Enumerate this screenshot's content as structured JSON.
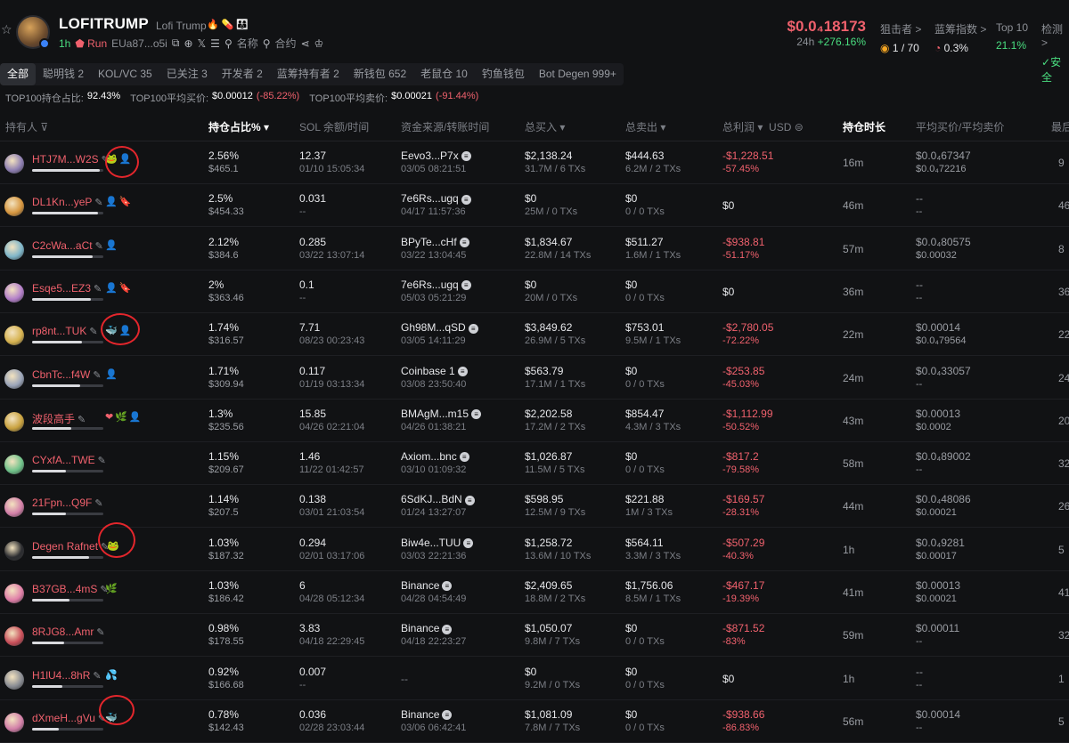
{
  "header": {
    "name": "LOFITRUMP",
    "sub": "Lofi Trump",
    "badges": [
      "🔥",
      "💊",
      "👨‍👩‍👦"
    ],
    "age": "1h",
    "run": "Run",
    "ca": "EUa87...o5i",
    "links": [
      "名称",
      "合约"
    ],
    "price": "$0.0₄18173",
    "change_label": "24h",
    "change": "+276.16%",
    "stats": [
      {
        "label": "狙击者 >",
        "value": "1 / 70",
        "green": false
      },
      {
        "label": "蓝筹指数 >",
        "value": "0.3%",
        "green": false
      },
      {
        "label": "Top 10",
        "value": "21.1%",
        "green": true
      },
      {
        "label": "检测 >",
        "value": "安全",
        "green": true
      }
    ]
  },
  "tabs": [
    "全部",
    "聪明钱 2",
    "KOL/VC 35",
    "已关注 3",
    "开发者 2",
    "蓝筹持有者 2",
    "新钱包 652",
    "老鼠仓 10",
    "钓鱼钱包",
    "Bot Degen 999+"
  ],
  "metrics": {
    "l1": "TOP100持仓占比:",
    "v1": "92.43%",
    "l2": "TOP100平均买价:",
    "v2": "$0.00012",
    "v2c": "(-85.22%)",
    "l3": "TOP100平均卖价:",
    "v3": "$0.00021",
    "v3c": "(-91.44%)"
  },
  "columns": [
    "持有人",
    "持仓占比%",
    "SOL 余额/时间",
    "资金来源/转账时间",
    "总买入",
    "总卖出",
    "总利润",
    "USD",
    "持仓时长",
    "平均买价/平均卖价",
    "最后"
  ],
  "colors": {
    "accent_red": "#f0616d",
    "accent_green": "#4ade80",
    "bg": "#111214"
  },
  "rows": [
    {
      "addr": "HTJ7M...W2S",
      "tags": [
        "🐸",
        "👤"
      ],
      "pct": "2.56%",
      "usd": "$465.1",
      "bar": 0.95,
      "sol": "12.37",
      "sol_t": "01/10 15:05:34",
      "src": "Eevo3...P7x",
      "src_t": "03/05 08:21:51",
      "buy": "$2,138.24",
      "buy_s": "31.7M / 6 TXs",
      "sell": "$444.63",
      "sell_s": "6.2M / 2 TXs",
      "profit": "-$1,228.51",
      "profit_p": "-57.45%",
      "hold": "16m",
      "avg_b": "$0.0₄67347",
      "avg_s": "$0.0₄72216",
      "last": "9",
      "av": "#8e7fb2"
    },
    {
      "addr": "DL1Kn...yeP",
      "tags": [
        "👤",
        "🔖"
      ],
      "pct": "2.5%",
      "usd": "$454.33",
      "bar": 0.93,
      "sol": "0.031",
      "sol_t": "--",
      "src": "7e6Rs...ugq",
      "src_t": "04/17 11:57:36",
      "buy": "$0",
      "buy_s": "25M / 0 TXs",
      "sell": "$0",
      "sell_s": "0 / 0 TXs",
      "profit": "$0",
      "profit_p": "",
      "hold": "46m",
      "avg_b": "--",
      "avg_s": "--",
      "last": "46",
      "av": "#d6963f"
    },
    {
      "addr": "C2cWa...aCt",
      "tags": [
        "👤"
      ],
      "pct": "2.12%",
      "usd": "$384.6",
      "bar": 0.85,
      "sol": "0.285",
      "sol_t": "03/22 13:07:14",
      "src": "BPyTe...cHf",
      "src_t": "03/22 13:04:45",
      "buy": "$1,834.67",
      "buy_s": "22.8M / 14 TXs",
      "sell": "$511.27",
      "sell_s": "1.6M / 1 TXs",
      "profit": "-$938.81",
      "profit_p": "-51.17%",
      "hold": "57m",
      "avg_b": "$0.0₄80575",
      "avg_s": "$0.00032",
      "last": "8",
      "av": "#7fb6c9"
    },
    {
      "addr": "Esqe5...EZ3",
      "tags": [
        "👤",
        "🔖"
      ],
      "pct": "2%",
      "usd": "$363.46",
      "bar": 0.82,
      "sol": "0.1",
      "sol_t": "--",
      "src": "7e6Rs...ugq",
      "src_t": "05/03 05:21:29",
      "buy": "$0",
      "buy_s": "20M / 0 TXs",
      "sell": "$0",
      "sell_s": "0 / 0 TXs",
      "profit": "$0",
      "profit_p": "",
      "hold": "36m",
      "avg_b": "--",
      "avg_s": "--",
      "last": "36",
      "av": "#b37fc9"
    },
    {
      "addr": "rp8nt...TUK",
      "tags": [
        "🐳",
        "👤"
      ],
      "pct": "1.74%",
      "usd": "$316.57",
      "bar": 0.7,
      "sol": "7.71",
      "sol_t": "08/23 00:23:43",
      "src": "Gh98M...qSD",
      "src_t": "03/05 14:11:29",
      "buy": "$3,849.62",
      "buy_s": "26.9M / 5 TXs",
      "sell": "$753.01",
      "sell_s": "9.5M / 1 TXs",
      "profit": "-$2,780.05",
      "profit_p": "-72.22%",
      "hold": "22m",
      "avg_b": "$0.00014",
      "avg_s": "$0.0₄79564",
      "last": "22",
      "av": "#d6b24f"
    },
    {
      "addr": "CbnTc...f4W",
      "tags": [
        "👤"
      ],
      "pct": "1.71%",
      "usd": "$309.94",
      "bar": 0.68,
      "sol": "0.117",
      "sol_t": "01/19 03:13:34",
      "src": "Coinbase 1",
      "src_t": "03/08 23:50:40",
      "buy": "$563.79",
      "buy_s": "17.1M / 1 TXs",
      "sell": "$0",
      "sell_s": "0 / 0 TXs",
      "profit": "-$253.85",
      "profit_p": "-45.03%",
      "hold": "24m",
      "avg_b": "$0.0₄33057",
      "avg_s": "--",
      "last": "24",
      "av": "#9aa4b8"
    },
    {
      "addr": "波段高手",
      "tags": [
        "❤",
        "🌿",
        "👤"
      ],
      "pct": "1.3%",
      "usd": "$235.56",
      "bar": 0.55,
      "sol": "15.85",
      "sol_t": "04/26 02:21:04",
      "src": "BMAgM...m15",
      "src_t": "04/26 01:38:21",
      "buy": "$2,202.58",
      "buy_s": "17.2M / 2 TXs",
      "sell": "$854.47",
      "sell_s": "4.3M / 3 TXs",
      "profit": "-$1,112.99",
      "profit_p": "-50.52%",
      "hold": "43m",
      "avg_b": "$0.00013",
      "avg_s": "$0.0002",
      "last": "20",
      "av": "#c9a23f"
    },
    {
      "addr": "CYxfA...TWE",
      "tags": [],
      "pct": "1.15%",
      "usd": "$209.67",
      "bar": 0.48,
      "sol": "1.46",
      "sol_t": "11/22 01:42:57",
      "src": "Axiom...bnc",
      "src_t": "03/10 01:09:32",
      "buy": "$1,026.87",
      "buy_s": "11.5M / 5 TXs",
      "sell": "$0",
      "sell_s": "0 / 0 TXs",
      "profit": "-$817.2",
      "profit_p": "-79.58%",
      "hold": "58m",
      "avg_b": "$0.0₄89002",
      "avg_s": "--",
      "last": "32",
      "av": "#6fc28a"
    },
    {
      "addr": "21Fpn...Q9F",
      "tags": [],
      "pct": "1.14%",
      "usd": "$207.5",
      "bar": 0.47,
      "sol": "0.138",
      "sol_t": "03/01 21:03:54",
      "src": "6SdKJ...BdN",
      "src_t": "01/24 13:27:07",
      "buy": "$598.95",
      "buy_s": "12.5M / 9 TXs",
      "sell": "$221.88",
      "sell_s": "1M / 3 TXs",
      "profit": "-$169.57",
      "profit_p": "-28.31%",
      "hold": "44m",
      "avg_b": "$0.0₄48086",
      "avg_s": "$0.00021",
      "last": "26",
      "av": "#d27fa8"
    },
    {
      "addr": "Degen Rafnet",
      "tags": [
        "🐸"
      ],
      "pct": "1.03%",
      "usd": "$187.32",
      "bar": 0.8,
      "sol": "0.294",
      "sol_t": "02/01 03:17:06",
      "src": "Biw4e...TUU",
      "src_t": "03/03 22:21:36",
      "buy": "$1,258.72",
      "buy_s": "13.6M / 10 TXs",
      "sell": "$564.11",
      "sell_s": "3.3M / 3 TXs",
      "profit": "-$507.29",
      "profit_p": "-40.3%",
      "hold": "1h",
      "avg_b": "$0.0₄9281",
      "avg_s": "$0.00017",
      "last": "5",
      "av": "#2b2c30"
    },
    {
      "addr": "B37GB...4mS",
      "tags": [
        "🌿"
      ],
      "pct": "1.03%",
      "usd": "$186.42",
      "bar": 0.53,
      "sol": "6",
      "sol_t": "04/28 05:12:34",
      "src": "Binance",
      "src_t": "04/28 04:54:49",
      "buy": "$2,409.65",
      "buy_s": "18.8M / 2 TXs",
      "sell": "$1,756.06",
      "sell_s": "8.5M / 1 TXs",
      "profit": "-$467.17",
      "profit_p": "-19.39%",
      "hold": "41m",
      "avg_b": "$0.00013",
      "avg_s": "$0.00021",
      "last": "41",
      "av": "#e07fa8"
    },
    {
      "addr": "8RJG8...Amr",
      "tags": [],
      "pct": "0.98%",
      "usd": "$178.55",
      "bar": 0.45,
      "sol": "3.83",
      "sol_t": "04/18 22:29:45",
      "src": "Binance",
      "src_t": "04/18 22:23:27",
      "buy": "$1,050.07",
      "buy_s": "9.8M / 7 TXs",
      "sell": "$0",
      "sell_s": "0 / 0 TXs",
      "profit": "-$871.52",
      "profit_p": "-83%",
      "hold": "59m",
      "avg_b": "$0.00011",
      "avg_s": "--",
      "last": "32",
      "av": "#c94f5a"
    },
    {
      "addr": "H1lU4...8hR",
      "tags": [
        "💦"
      ],
      "pct": "0.92%",
      "usd": "$166.68",
      "bar": 0.42,
      "sol": "0.007",
      "sol_t": "--",
      "src": "--",
      "src_t": "",
      "buy": "$0",
      "buy_s": "9.2M / 0 TXs",
      "sell": "$0",
      "sell_s": "0 / 0 TXs",
      "profit": "$0",
      "profit_p": "",
      "hold": "1h",
      "avg_b": "--",
      "avg_s": "--",
      "last": "1",
      "av": "#8a8d94"
    },
    {
      "addr": "dXmeH...gVu",
      "tags": [
        "🐳"
      ],
      "pct": "0.78%",
      "usd": "$142.43",
      "bar": 0.38,
      "sol": "0.036",
      "sol_t": "02/28 23:03:44",
      "src": "Binance",
      "src_t": "03/06 06:42:41",
      "buy": "$1,081.09",
      "buy_s": "7.8M / 7 TXs",
      "sell": "$0",
      "sell_s": "0 / 0 TXs",
      "profit": "-$938.66",
      "profit_p": "-86.83%",
      "hold": "56m",
      "avg_b": "$0.00014",
      "avg_s": "--",
      "last": "5",
      "av": "#d27fa8"
    }
  ]
}
